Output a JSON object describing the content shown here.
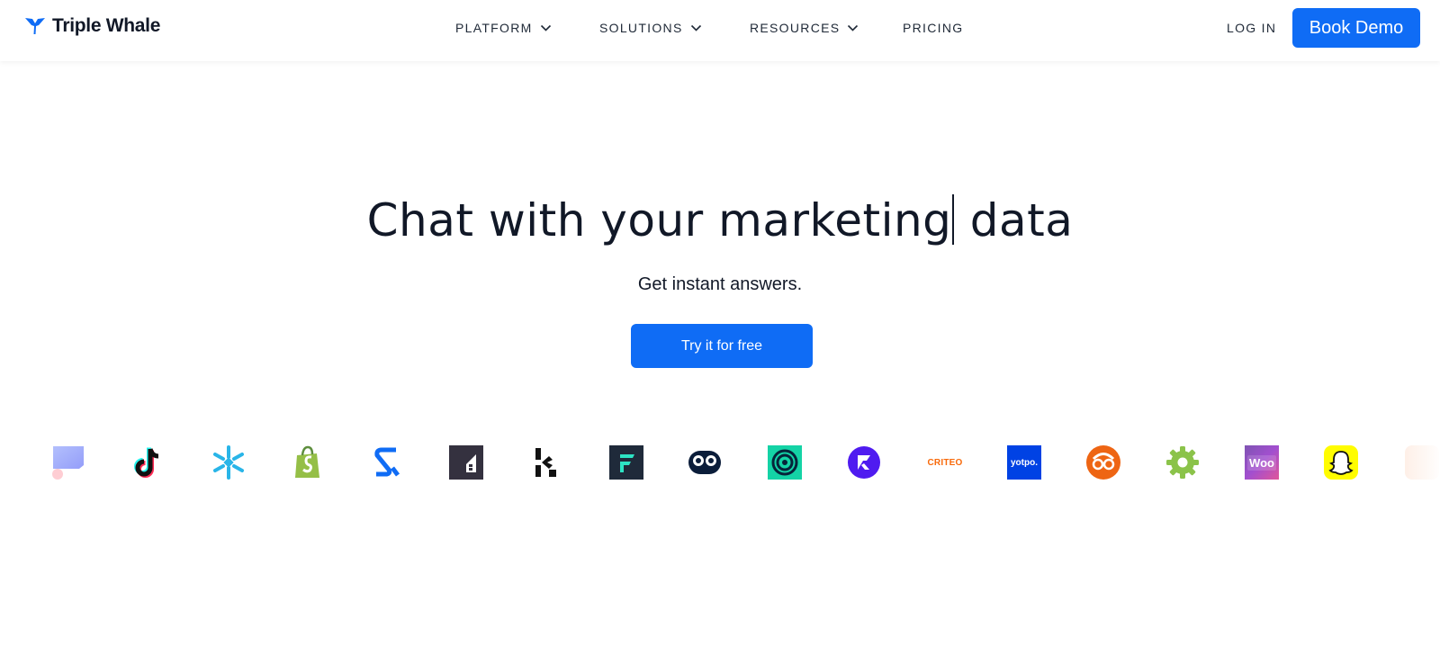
{
  "brand": {
    "name": "Triple Whale",
    "accent": "#0f6cf5"
  },
  "nav": {
    "items": [
      {
        "label": "PLATFORM",
        "has_dropdown": true
      },
      {
        "label": "SOLUTIONS",
        "has_dropdown": true
      },
      {
        "label": "RESOURCES",
        "has_dropdown": true
      },
      {
        "label": "PRICING",
        "has_dropdown": false
      }
    ],
    "login_label": "LOG IN",
    "book_demo_label": "Book Demo"
  },
  "hero": {
    "title_before_cursor": "Chat with your marketing",
    "title_after_cursor": " data",
    "subtitle": "Get instant answers.",
    "cta_label": "Try it for free"
  },
  "integrations": [
    {
      "icon": "chat-app-icon"
    },
    {
      "icon": "tiktok-icon"
    },
    {
      "icon": "snowflake-icon"
    },
    {
      "icon": "shopify-icon"
    },
    {
      "icon": "s-logo-icon"
    },
    {
      "icon": "bigcommerce-icon"
    },
    {
      "icon": "klaviyo-icon"
    },
    {
      "icon": "f-logo-icon"
    },
    {
      "icon": "recharge-icon"
    },
    {
      "icon": "circle-logo-icon"
    },
    {
      "icon": "r-logo-icon"
    },
    {
      "icon": "criteo-icon",
      "text": "CRITEO"
    },
    {
      "icon": "yotpo-icon",
      "text": "yotpo."
    },
    {
      "icon": "outbrain-icon"
    },
    {
      "icon": "gear-icon"
    },
    {
      "icon": "woocommerce-icon",
      "text": "Woo"
    },
    {
      "icon": "snapchat-icon"
    },
    {
      "icon": "partial-logo-icon"
    }
  ]
}
